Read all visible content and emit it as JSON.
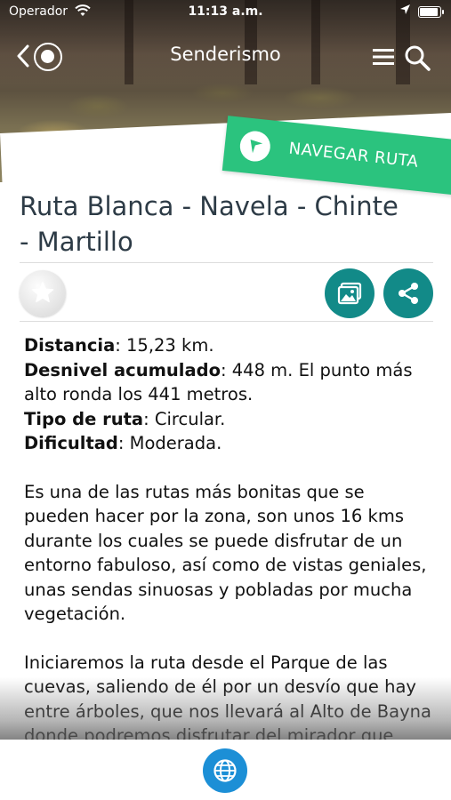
{
  "status_bar": {
    "carrier": "Operador",
    "time": "11:13 a.m."
  },
  "nav": {
    "title": "Senderismo",
    "icons": [
      "back-chevron-icon",
      "app-logo-icon",
      "menu-icon",
      "search-icon"
    ]
  },
  "hero": {
    "navigate_label": "NAVEGAR RUTA",
    "navigate_icon": "navigation-arrow-icon"
  },
  "route": {
    "title_line1": "Ruta Blanca - Navela - Chinte",
    "title_line2": "- Martillo"
  },
  "actions": {
    "favorite_icon": "star-icon",
    "gallery_icon": "gallery-icon",
    "share_icon": "share-icon"
  },
  "specs": {
    "distance_label": "Distancia",
    "distance_value": ": 15,23 km.",
    "elevation_label": "Desnivel acumulado",
    "elevation_value": ": 448 m. El punto más alto ronda los 441 metros.",
    "type_label": "Tipo de ruta",
    "type_value": ": Circular.",
    "difficulty_label": "Dificultad",
    "difficulty_value": ": Moderada."
  },
  "description": {
    "paragraph1": "Es una de las rutas más bonitas que se pueden hacer por la zona, son unos 16 kms durante los cuales se puede disfrutar de un entorno fabuloso, así como de vistas geniales, unas sendas sinuosas y pobladas por mucha vegetación.",
    "paragraph2": "Iniciaremos la ruta desde el Parque de las cuevas, saliendo de él por un desvío que hay entre árboles, que nos llevará al Alto de Bayna donde podremos disfrutar del mirador que"
  },
  "bottom_bar": {
    "icon": "globe-icon"
  },
  "colors": {
    "accent_green": "#2bc37e",
    "teal": "#128a88",
    "globe_blue": "#1c8fd6",
    "title_text": "#2d3b46"
  }
}
